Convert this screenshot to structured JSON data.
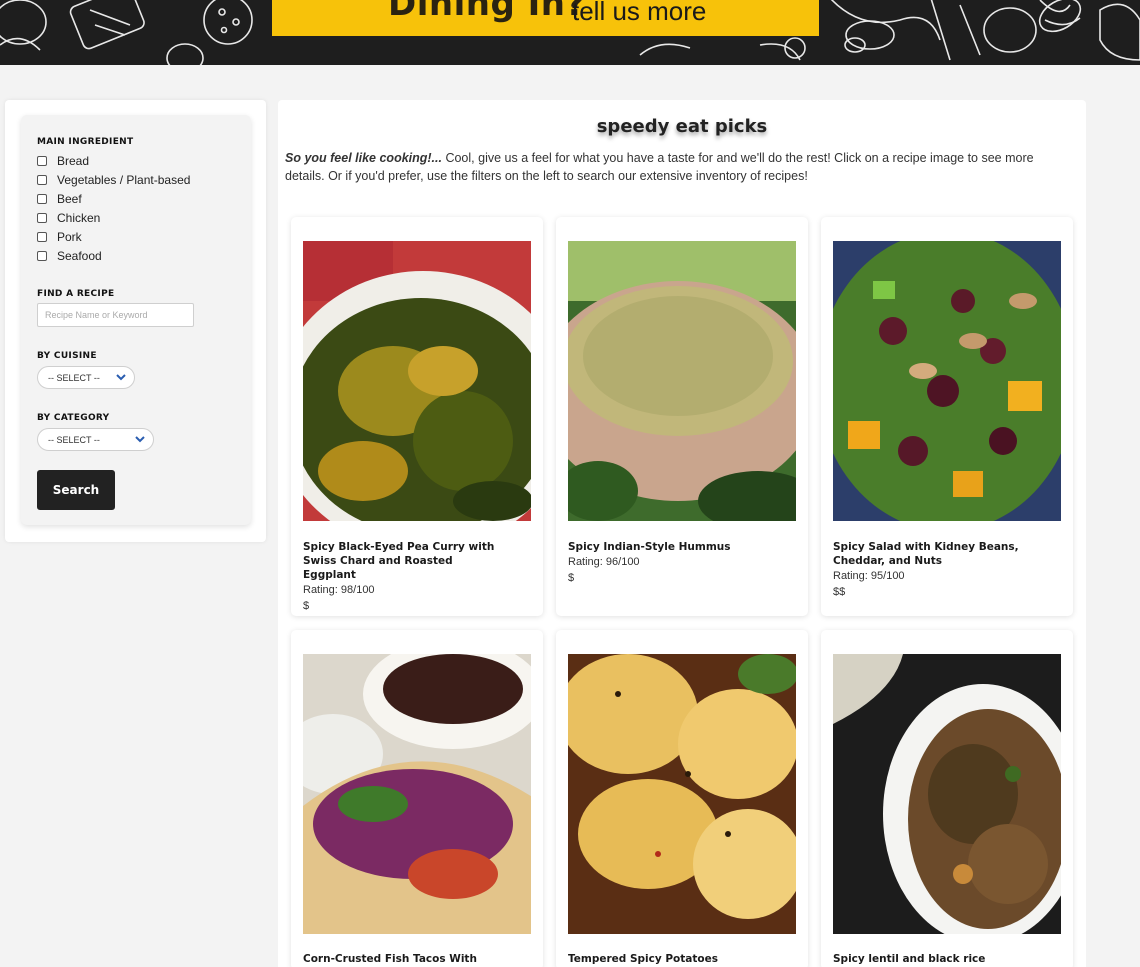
{
  "banner": {
    "strong": "Dining In?",
    "light": "tell us more"
  },
  "filters": {
    "main_ingredient_title": "MAIN INGREDIENT",
    "ingredients": [
      "Bread",
      "Vegetables / Plant-based",
      "Beef",
      "Chicken",
      "Pork",
      "Seafood"
    ],
    "find_title": "FIND A RECIPE",
    "find_placeholder": "Recipe Name or Keyword",
    "cuisine_title": "BY CUISINE",
    "cuisine_selected": "-- SELECT --",
    "category_title": "BY CATEGORY",
    "category_selected": "-- SELECT --",
    "search_label": "Search"
  },
  "main": {
    "title": "speedy eat picks",
    "intro_em": "So you feel like cooking!...",
    "intro_text": " Cool, give us a feel for what you have a taste for and we'll do the rest! Click on a recipe image to see more details. Or if you'd prefer, use the filters on the left to search our extensive inventory of recipes!"
  },
  "recipes": [
    {
      "name": "Spicy Black-Eyed Pea Curry with Swiss Chard and Roasted Eggplant",
      "rating": "Rating: 98/100",
      "price": "$"
    },
    {
      "name": "Spicy Indian-Style Hummus",
      "rating": "Rating: 96/100",
      "price": "$"
    },
    {
      "name": "Spicy Salad with Kidney Beans, Cheddar, and Nuts",
      "rating": "Rating: 95/100",
      "price": "$$"
    },
    {
      "name": "Corn-Crusted Fish Tacos With",
      "rating": "",
      "price": ""
    },
    {
      "name": "Tempered Spicy Potatoes",
      "rating": "",
      "price": ""
    },
    {
      "name": "Spicy lentil and black rice",
      "rating": "",
      "price": ""
    }
  ],
  "colors": {
    "banner_bg": "#1e1e1e",
    "banner_accent": "#f7c20a",
    "button": "#222222"
  }
}
